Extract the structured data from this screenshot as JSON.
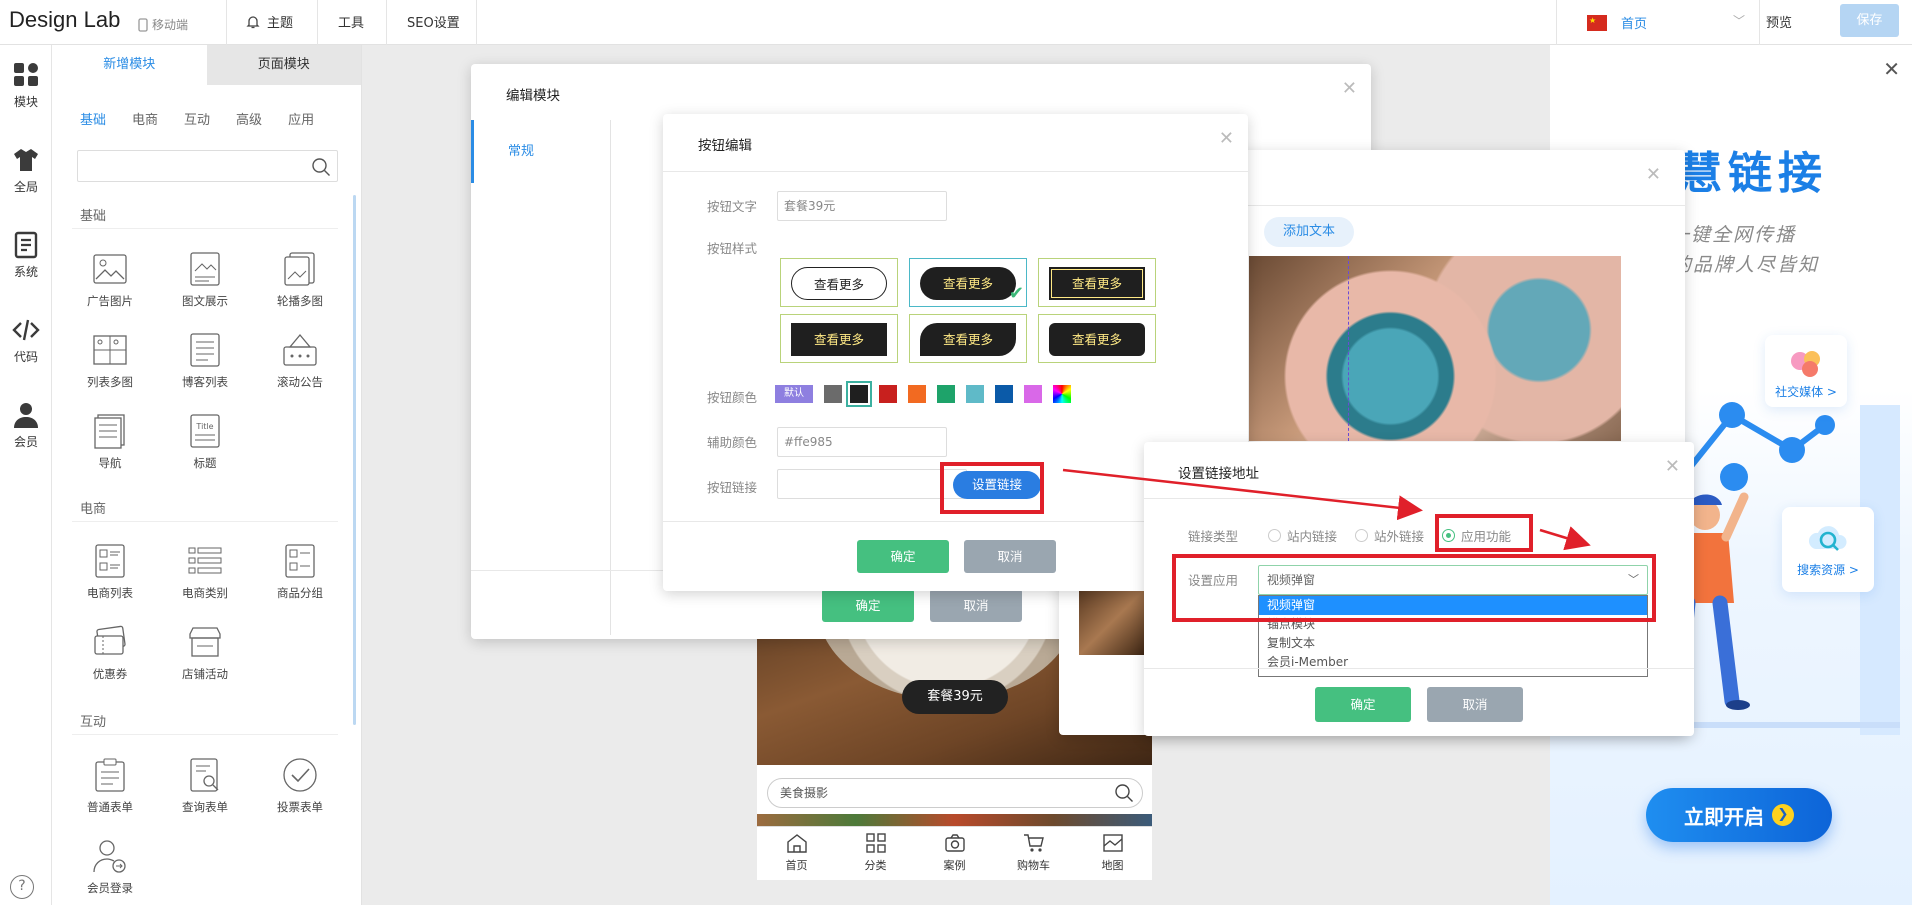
{
  "topbar": {
    "brand": "Design Lab",
    "mobile": "移动端",
    "nav": [
      {
        "label": "主题"
      },
      {
        "label": "工具"
      },
      {
        "label": "SEO设置"
      }
    ],
    "page_selected": "首页",
    "preview": "预览",
    "save": "保存"
  },
  "rail": [
    {
      "label": "模块",
      "icon": "grid-icon"
    },
    {
      "label": "全局",
      "icon": "shirt-icon"
    },
    {
      "label": "系统",
      "icon": "document-icon"
    },
    {
      "label": "代码",
      "icon": "code-icon"
    },
    {
      "label": "会员",
      "icon": "user-icon"
    }
  ],
  "panel": {
    "tabs": [
      "新增模块",
      "页面模块"
    ],
    "subtabs": [
      "基础",
      "电商",
      "互动",
      "高级",
      "应用"
    ],
    "sections": [
      {
        "title": "基础",
        "items": [
          "广告图片",
          "图文展示",
          "轮播多图",
          "列表多图",
          "博客列表",
          "滚动公告",
          "导航",
          "标题"
        ]
      },
      {
        "title": "电商",
        "items": [
          "电商列表",
          "电商类别",
          "商品分组",
          "优惠券",
          "店铺活动"
        ]
      },
      {
        "title": "互动",
        "items": [
          "普通表单",
          "查询表单",
          "投票表单",
          "会员登录"
        ]
      }
    ]
  },
  "phone": {
    "pill_button": "套餐39元",
    "search_placeholder": "美食摄影",
    "nav": [
      "首页",
      "分类",
      "案例",
      "购物车",
      "地图"
    ]
  },
  "dialog_edit": {
    "title": "编辑模块",
    "side_tab": "常规",
    "confirm": "确定",
    "cancel": "取消"
  },
  "dialog_image": {
    "chip": "添加文本"
  },
  "dialog_button": {
    "title": "按钮编辑",
    "text_label": "按钮文字",
    "text_value": "套餐39元",
    "style_label": "按钮样式",
    "style_sample": "查看更多",
    "color_label": "按钮颜色",
    "color_default": "默认",
    "colors": [
      "#6b6b6b",
      "#1f1f1f",
      "#c8201e",
      "#f26a21",
      "#1ea36a",
      "#5fbac8",
      "#0b5aa8",
      "#d968e8"
    ],
    "aux_label": "辅助颜色",
    "aux_value": "#ffe985",
    "link_label": "按钮链接",
    "set_link": "设置链接",
    "confirm": "确定",
    "cancel": "取消"
  },
  "dialog_link": {
    "title": "设置链接地址",
    "type_label": "链接类型",
    "types": [
      "站内链接",
      "站外链接",
      "应用功能"
    ],
    "selected_type": "应用功能",
    "app_label": "设置应用",
    "app_value": "视频弹窗",
    "options": [
      "视频弹窗",
      "锚点模块",
      "复制文本",
      "会员i-Member"
    ],
    "confirm": "确定",
    "cancel": "取消"
  },
  "promo": {
    "title": "智慧链接",
    "sub1": "一键全网传播",
    "sub2": "让您的品牌人尽皆知",
    "card_social": "社交媒体 >",
    "card_search": "搜索资源 >",
    "cta": "立即开启"
  },
  "colors": {
    "accent": "#2a8ce5",
    "confirm_green": "#45c080",
    "cancel_gray": "#9aa6b0",
    "annotation_red": "#e0202a"
  }
}
